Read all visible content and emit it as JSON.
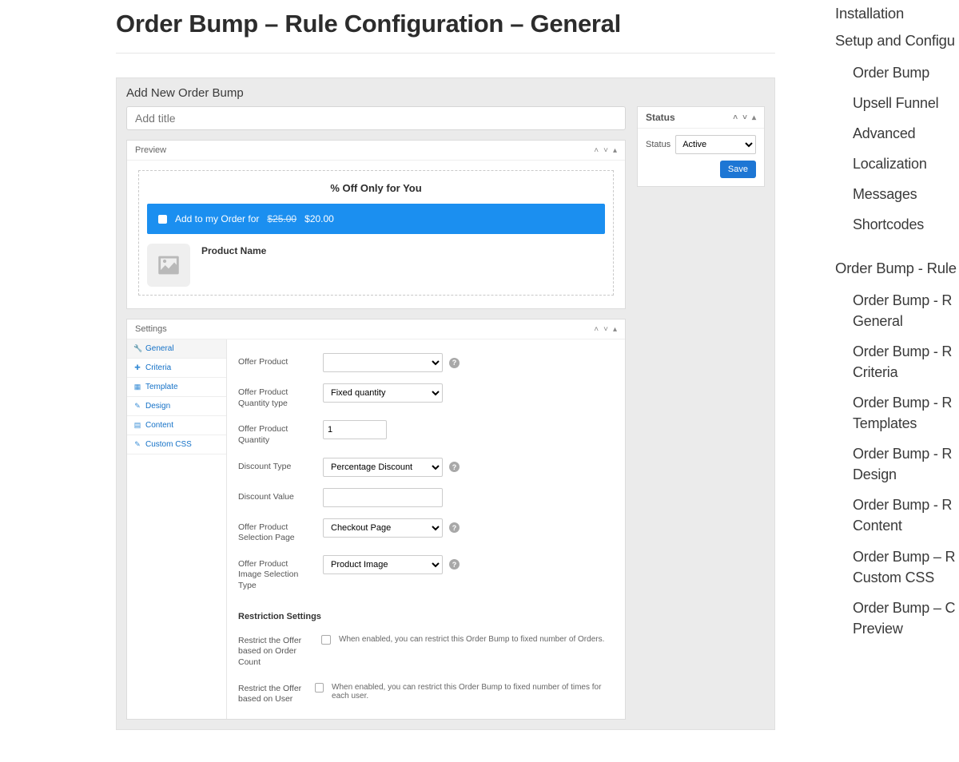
{
  "page": {
    "title": "Order Bump – Rule Configuration – General"
  },
  "admin": {
    "heading": "Add New Order Bump",
    "title_placeholder": "Add title"
  },
  "preview_box": {
    "header": "Preview",
    "headline": "% Off Only for You",
    "offer_prefix": "Add to my Order for",
    "old_price": "$25.00",
    "new_price": "$20.00",
    "product_name": "Product Name"
  },
  "status_box": {
    "header": "Status",
    "label": "Status",
    "value": "Active",
    "save": "Save"
  },
  "settings": {
    "header": "Settings",
    "tabs": {
      "general": "General",
      "criteria": "Criteria",
      "template": "Template",
      "design": "Design",
      "content": "Content",
      "custom_css": "Custom CSS"
    },
    "fields": {
      "offer_product": "Offer Product",
      "qty_type_label": "Offer Product Quantity type",
      "qty_type_value": "Fixed quantity",
      "qty_label": "Offer Product Quantity",
      "qty_value": "1",
      "discount_type_label": "Discount Type",
      "discount_type_value": "Percentage Discount",
      "discount_value_label": "Discount Value",
      "selection_page_label": "Offer Product Selection Page",
      "selection_page_value": "Checkout Page",
      "image_type_label": "Offer Product Image Selection Type",
      "image_type_value": "Product Image"
    },
    "restriction": {
      "heading": "Restriction Settings",
      "order_count_label": "Restrict the Offer based on Order Count",
      "order_count_hint": "When enabled, you can restrict this Order Bump to fixed number of Orders.",
      "user_label": "Restrict the Offer based on User",
      "user_hint": "When enabled, you can restrict this Order Bump to fixed number of times for each user."
    }
  },
  "sidebar": {
    "items": [
      {
        "label": "Installation",
        "children": []
      },
      {
        "label": "Setup and Configu",
        "children": [
          {
            "label": "Order Bump"
          },
          {
            "label": "Upsell Funnel"
          },
          {
            "label": "Advanced"
          },
          {
            "label": "Localization"
          },
          {
            "label": "Messages"
          },
          {
            "label": "Shortcodes"
          }
        ]
      },
      {
        "label": "Order Bump - Rule",
        "children": [
          {
            "label": "Order Bump - R General"
          },
          {
            "label": "Order Bump - R Criteria"
          },
          {
            "label": "Order Bump - R Templates"
          },
          {
            "label": "Order Bump - R Design"
          },
          {
            "label": "Order Bump - R Content"
          },
          {
            "label": "Order Bump – R Custom CSS"
          },
          {
            "label": "Order Bump – C Preview"
          }
        ]
      }
    ]
  }
}
